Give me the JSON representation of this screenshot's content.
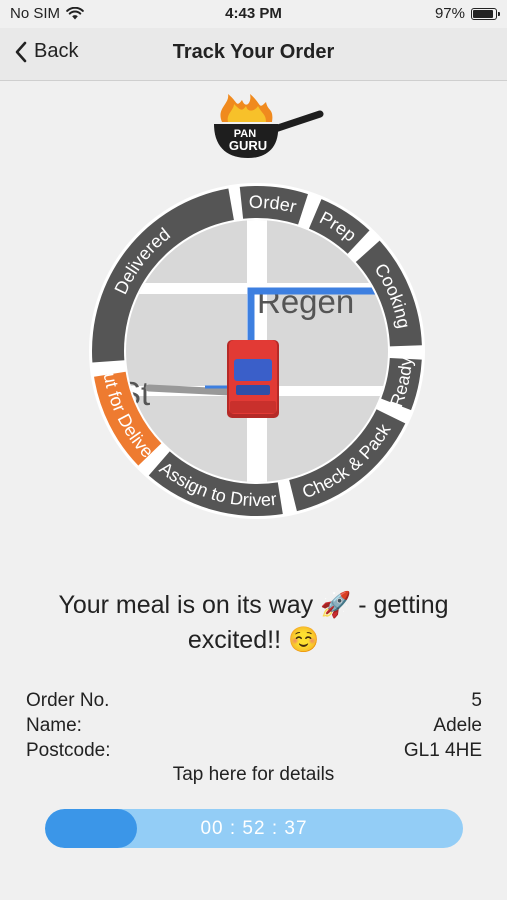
{
  "status_bar": {
    "carrier": "No SIM",
    "time": "4:43 PM",
    "battery": "97%",
    "battery_level": 0.97
  },
  "nav": {
    "back_label": "Back",
    "title": "Track Your Order"
  },
  "logo": {
    "line1": "PAN",
    "line2": "GURU"
  },
  "tracker": {
    "segments": [
      {
        "label": "Order",
        "active": false
      },
      {
        "label": "Prep",
        "active": false
      },
      {
        "label": "Cooking",
        "active": false
      },
      {
        "label": "Ready",
        "active": false
      },
      {
        "label": "Check & Pack",
        "active": false
      },
      {
        "label": "Assign to Driver",
        "active": false
      },
      {
        "label": "Out for Delivery",
        "active": true
      },
      {
        "label": "Delivered",
        "active": false
      }
    ],
    "map_street_1": "Regen",
    "map_street_2": "St",
    "colors": {
      "active": "#ee7b30",
      "inactive": "#555555",
      "route": "#3d7fe0",
      "car": "#e23a35"
    }
  },
  "message": {
    "line1": "Your meal is on its way 🚀 - getting",
    "line2": "excited!! ☺️"
  },
  "order": {
    "number_label": "Order No.",
    "number_value": "5",
    "name_label": "Name:",
    "name_value": "Adele",
    "postcode_label": "Postcode:",
    "postcode_value": "GL1 4HE"
  },
  "tap_details": "Tap here for details",
  "countdown": {
    "value": "00 : 52 : 37",
    "progress": 0.22
  }
}
